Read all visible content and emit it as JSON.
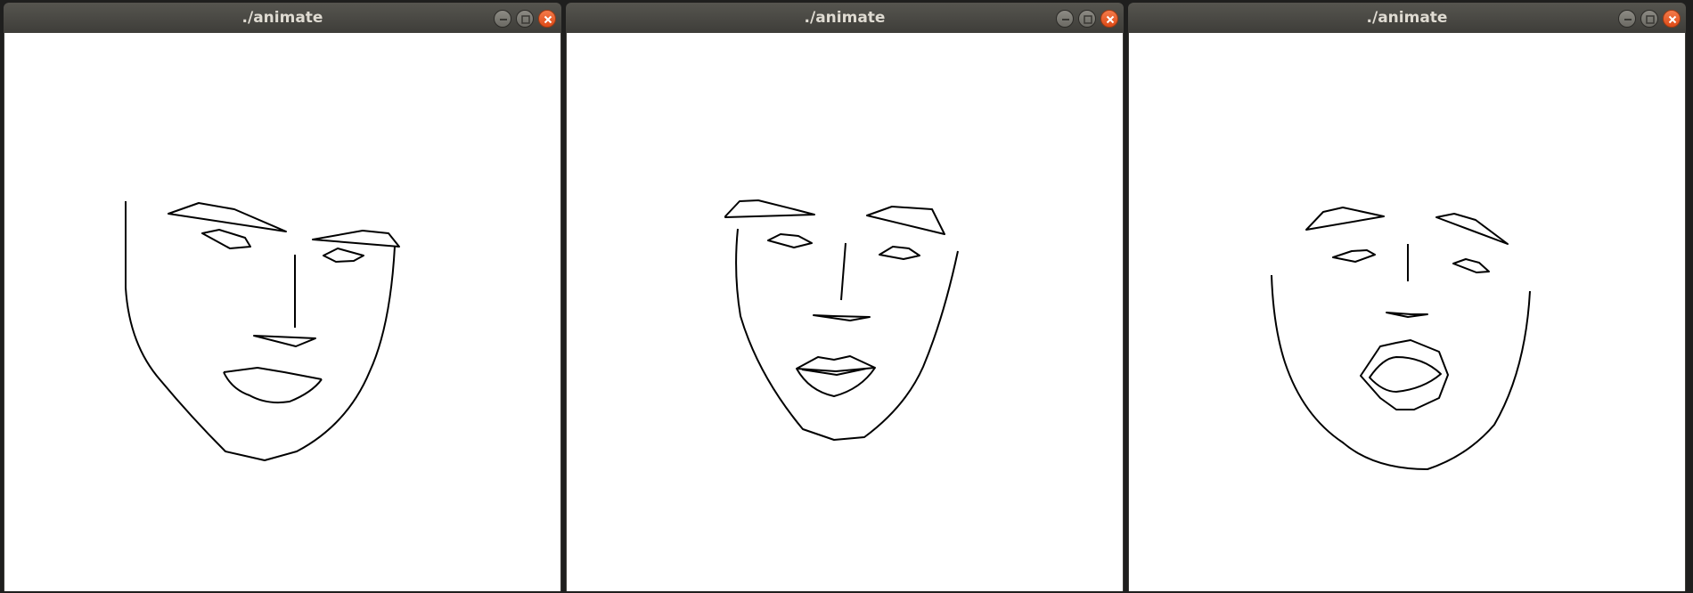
{
  "windows": [
    {
      "title": "./animate",
      "canvas": "face-drawing-neutral"
    },
    {
      "title": "./animate",
      "canvas": "face-drawing-smile"
    },
    {
      "title": "./animate",
      "canvas": "face-drawing-open-mouth"
    }
  ],
  "icons": {
    "minimize": "minimize-icon",
    "maximize": "maximize-icon",
    "close": "close-icon"
  },
  "colors": {
    "titlebar": "#4a4944",
    "close_button": "#e9581f",
    "canvas_bg": "#ffffff",
    "stroke": "#000000"
  }
}
